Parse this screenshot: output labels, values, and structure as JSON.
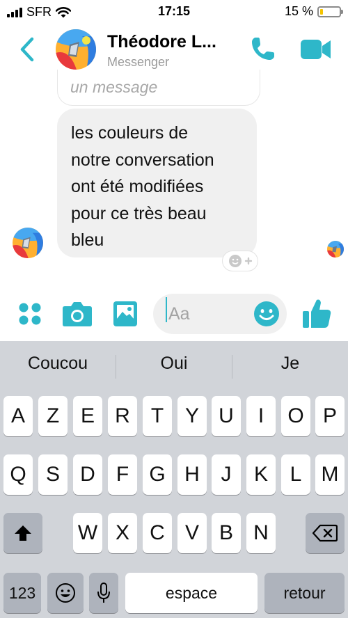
{
  "status_bar": {
    "carrier": "SFR",
    "time": "17:15",
    "battery_percent_label": "15 %",
    "battery_level": 0.15
  },
  "header": {
    "contact_name": "Théodore L...",
    "subtitle": "Messenger",
    "icons": [
      "back-chevron-icon",
      "phone-icon",
      "video-camera-icon"
    ],
    "accent_color": "#2eb7c9"
  },
  "conversation": {
    "previous_message_fragment": "un message",
    "message_text": "les couleurs de notre conversation ont été modifiées pour ce très beau bleu",
    "message_lines": [
      "les couleurs de",
      "notre conversation",
      "ont été modifiées",
      "pour ce très beau",
      "bleu"
    ]
  },
  "composer": {
    "placeholder": "Aa",
    "value": "",
    "icons": [
      "apps-grid-icon",
      "camera-icon",
      "image-icon",
      "emoji-icon",
      "thumbs-up-icon"
    ]
  },
  "keyboard": {
    "suggestions": [
      "Coucou",
      "Oui",
      "Je"
    ],
    "rows": [
      [
        "A",
        "Z",
        "E",
        "R",
        "T",
        "Y",
        "U",
        "I",
        "O",
        "P"
      ],
      [
        "Q",
        "S",
        "D",
        "F",
        "G",
        "H",
        "J",
        "K",
        "L",
        "M"
      ],
      [
        "W",
        "X",
        "C",
        "V",
        "B",
        "N"
      ]
    ],
    "numbers_key": "123",
    "space_key": "espace",
    "return_key": "retour"
  }
}
